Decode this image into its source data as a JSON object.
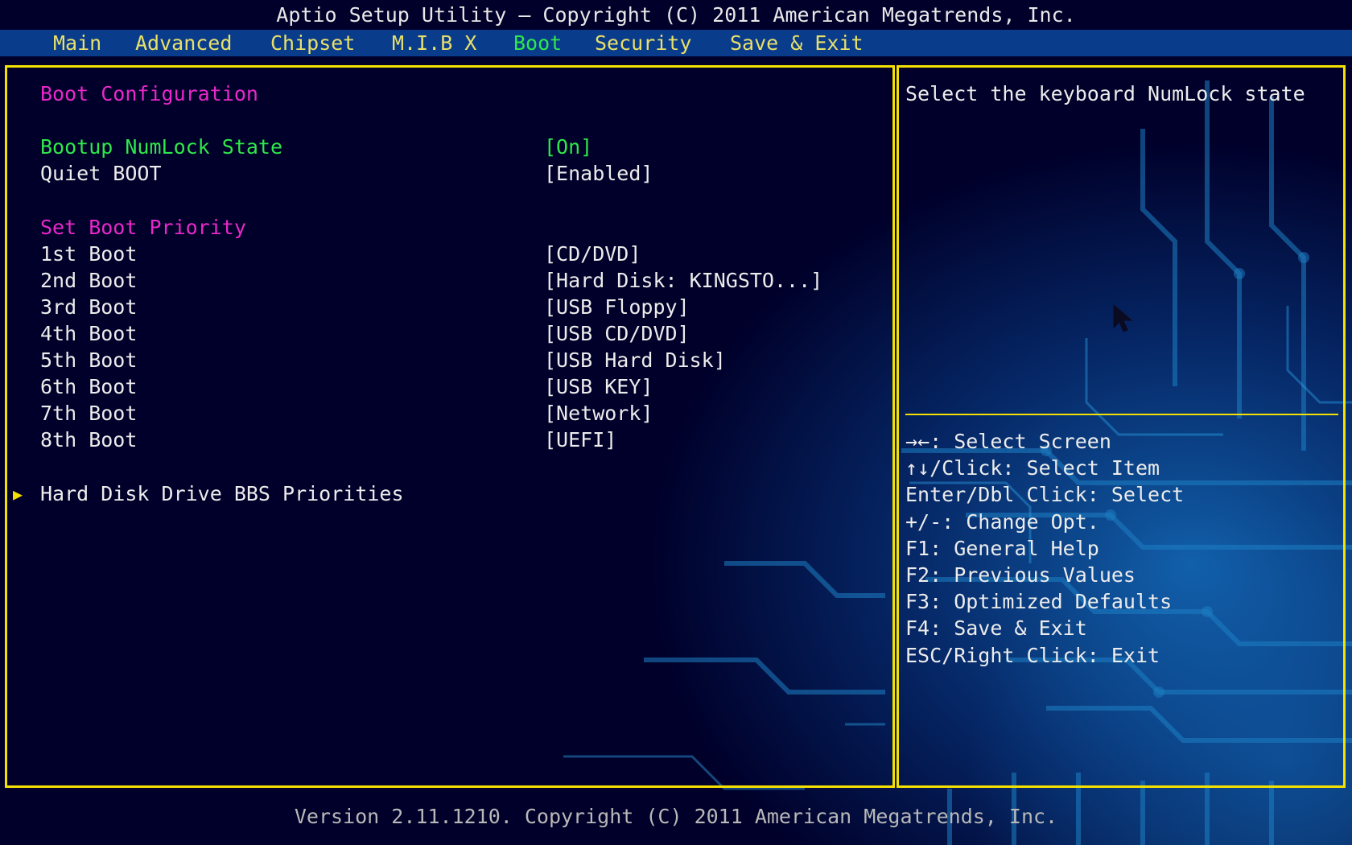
{
  "title": "Aptio Setup Utility – Copyright (C) 2011 American Megatrends, Inc.",
  "menu": {
    "items": [
      "Main",
      "Advanced",
      "Chipset",
      "M.I.B X",
      "Boot",
      "Security",
      "Save & Exit"
    ],
    "active": "Boot"
  },
  "main": {
    "section_boot_config": "Boot Configuration",
    "numlock": {
      "label": "Bootup NumLock State",
      "value": "[On]"
    },
    "quiet": {
      "label": "Quiet BOOT",
      "value": "[Enabled]"
    },
    "section_priority": "Set Boot Priority",
    "boot_order": [
      {
        "label": "1st Boot",
        "value": "[CD/DVD]"
      },
      {
        "label": "2nd Boot",
        "value": "[Hard Disk: KINGSTO...]"
      },
      {
        "label": "3rd Boot",
        "value": "[USB Floppy]"
      },
      {
        "label": "4th Boot",
        "value": "[USB CD/DVD]"
      },
      {
        "label": "5th Boot",
        "value": "[USB Hard Disk]"
      },
      {
        "label": "6th Boot",
        "value": "[USB KEY]"
      },
      {
        "label": "7th Boot",
        "value": "[Network]"
      },
      {
        "label": "8th Boot",
        "value": "[UEFI]"
      }
    ],
    "submenu": "Hard Disk Drive BBS Priorities"
  },
  "help": {
    "text": "Select the keyboard NumLock state",
    "keys": [
      "→←: Select Screen",
      "↑↓/Click: Select Item",
      "Enter/Dbl Click: Select",
      "+/-: Change Opt.",
      "F1: General Help",
      "F2: Previous Values",
      "F3: Optimized Defaults",
      "F4: Save & Exit",
      "ESC/Right Click: Exit"
    ]
  },
  "footer": "Version 2.11.1210. Copyright (C) 2011 American Megatrends, Inc.",
  "colors": {
    "border": "#f5e100",
    "menu_text": "#e8e06a",
    "selected": "#2ee84a",
    "heading": "#e828c8",
    "menubar_bg": "#0a3c8c"
  }
}
